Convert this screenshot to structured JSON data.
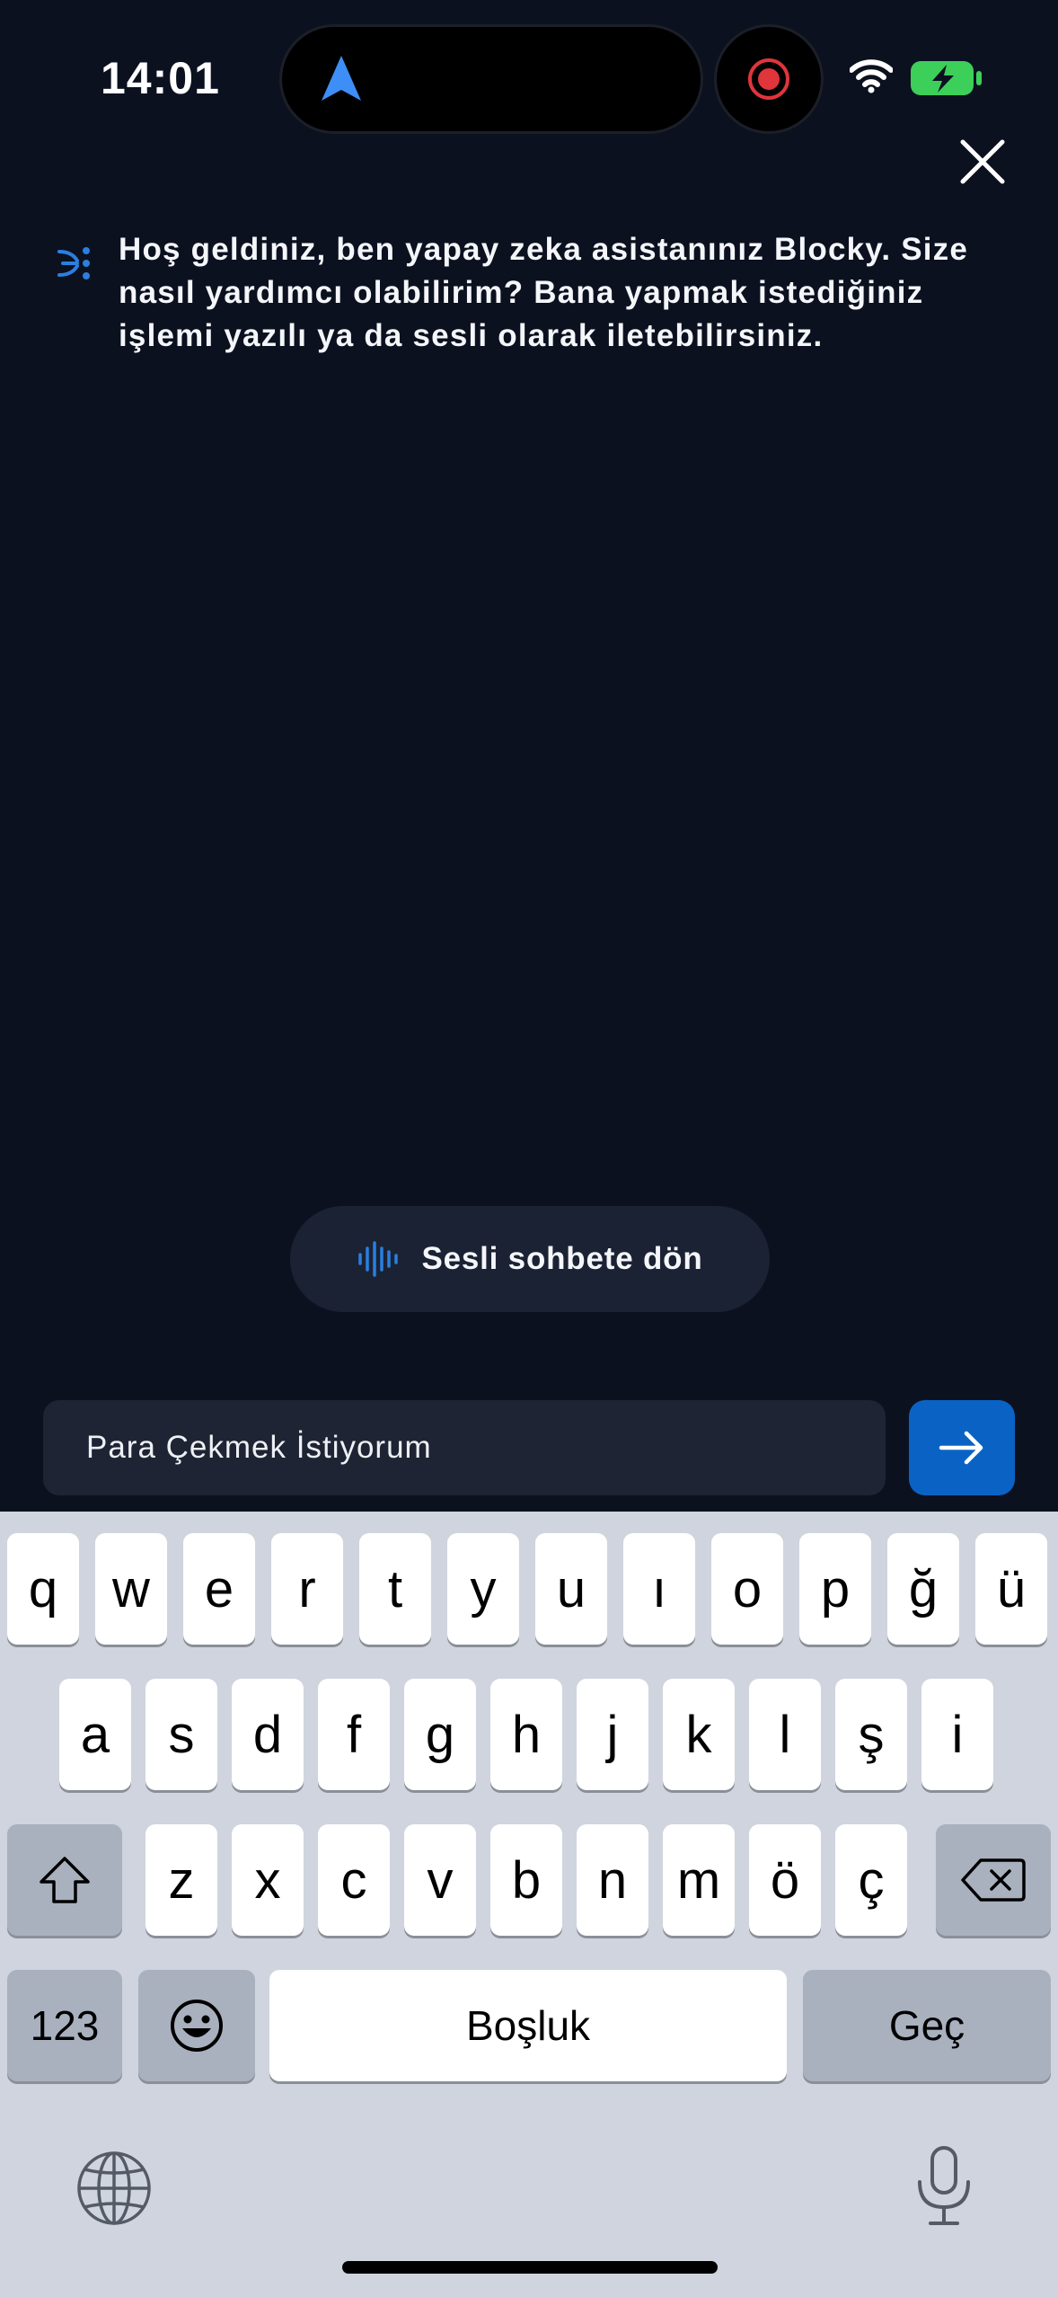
{
  "status_bar": {
    "time": "14:01"
  },
  "chat": {
    "bot_message": "Hoş geldiniz, ben yapay zeka asistanınız Blocky. Size nasıl yardımcı olabilirim? Bana yapmak istediğiniz işlemi yazılı ya da sesli olarak iletebilirsiniz.",
    "voice_button_label": "Sesli sohbete dön"
  },
  "composer": {
    "input_value": "Para Çekmek İstiyorum"
  },
  "keyboard": {
    "row1": [
      "q",
      "w",
      "e",
      "r",
      "t",
      "y",
      "u",
      "ı",
      "o",
      "p",
      "ğ",
      "ü"
    ],
    "row2": [
      "a",
      "s",
      "d",
      "f",
      "g",
      "h",
      "j",
      "k",
      "l",
      "ş",
      "i"
    ],
    "row3": [
      "z",
      "x",
      "c",
      "v",
      "b",
      "n",
      "m",
      "ö",
      "ç"
    ],
    "numbers_label": "123",
    "space_label": "Boşluk",
    "return_label": "Geç"
  },
  "colors": {
    "background": "#0c1120",
    "accent": "#0a63c4",
    "pill": "#1b2233",
    "input": "#1e2433"
  }
}
